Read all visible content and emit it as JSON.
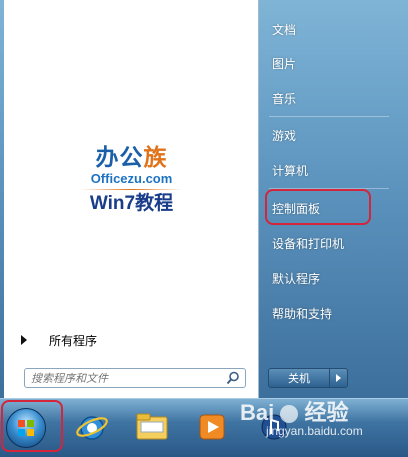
{
  "logo": {
    "title_main": "办公",
    "title_accent": "族",
    "site": "Officezu.com",
    "subtitle": "Win7教程"
  },
  "left_pane": {
    "all_programs": "所有程序",
    "search_placeholder": "搜索程序和文件"
  },
  "right_pane": {
    "items": [
      {
        "label": "文档"
      },
      {
        "label": "图片"
      },
      {
        "label": "音乐"
      },
      {
        "label": "游戏"
      },
      {
        "label": "计算机"
      },
      {
        "label": "控制面板"
      },
      {
        "label": "设备和打印机"
      },
      {
        "label": "默认程序"
      },
      {
        "label": "帮助和支持"
      }
    ],
    "shutdown_label": "关机"
  },
  "watermark": {
    "brand": "Bai",
    "brand_cn": "经验",
    "url": "jingyan.baidu.com"
  },
  "colors": {
    "highlight": "#d4253a",
    "logo_blue": "#1a5fa8",
    "logo_orange": "#e0731a"
  },
  "icons": {
    "start": "windows-orb-icon",
    "ie": "internet-explorer-icon",
    "explorer": "folder-icon",
    "media": "media-player-icon",
    "app": "media-center-icon"
  }
}
